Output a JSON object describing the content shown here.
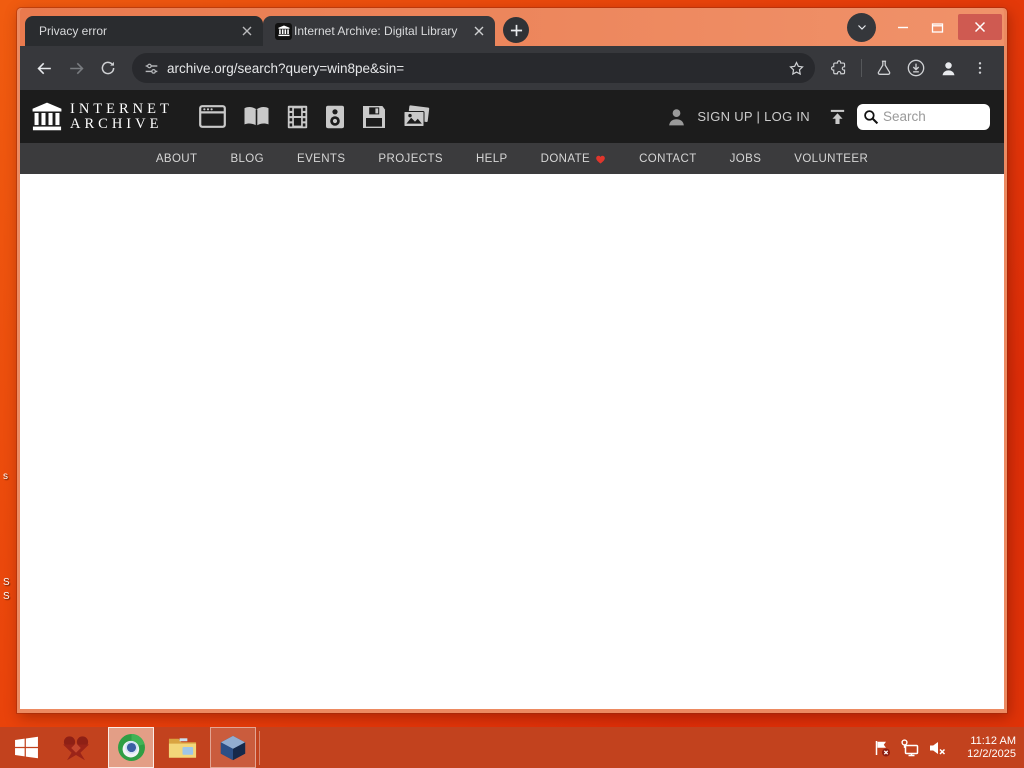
{
  "browser": {
    "tabs": [
      {
        "title": "Privacy error",
        "active": false
      },
      {
        "title": "Internet Archive: Digital Library",
        "active": true
      }
    ],
    "url": "archive.org/search?query=win8pe&sin="
  },
  "archive": {
    "wordmark_line1": "INTERNET",
    "wordmark_line2": "ARCHIVE",
    "auth_text": "SIGN UP | LOG IN",
    "search_placeholder": "Search",
    "media_types": [
      "web",
      "texts",
      "video",
      "audio",
      "software",
      "images"
    ],
    "nav_items": [
      {
        "label": "ABOUT"
      },
      {
        "label": "BLOG"
      },
      {
        "label": "EVENTS"
      },
      {
        "label": "PROJECTS"
      },
      {
        "label": "HELP"
      },
      {
        "label": "DONATE",
        "has_heart": true
      },
      {
        "label": "CONTACT"
      },
      {
        "label": "JOBS"
      },
      {
        "label": "VOLUNTEER"
      }
    ]
  },
  "desktop": {
    "icon_label_fragments": [
      "s",
      "S",
      "S"
    ]
  },
  "taskbar": {
    "time": "11:12 AM",
    "date": "12/2/2025"
  },
  "colors": {
    "desktop_red": "#e8400a",
    "taskbar_red": "#c2421e",
    "window_frame_salmon": "#ec8a61",
    "chrome_dark": "#37383c",
    "omnibox_dark": "#28292d",
    "ia_header_dark": "#1c1c1c",
    "ia_nav_gray": "#3b3b3d",
    "donate_heart_red": "#e0362c",
    "close_button_red": "#cf5a51"
  }
}
